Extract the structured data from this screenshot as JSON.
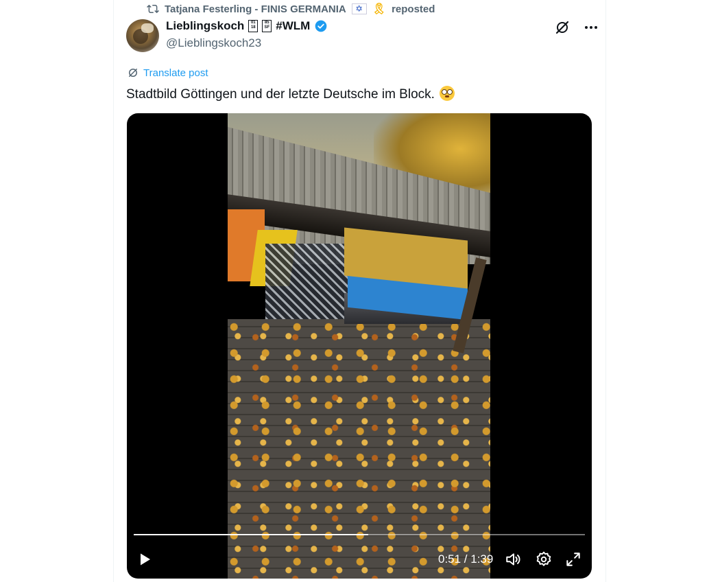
{
  "repost": {
    "user": "Tatjana Festerling - FINIS GERMANIA",
    "action": "reposted"
  },
  "author": {
    "name": "Lieblingskoch",
    "tag": "#WLM",
    "handle": "@Lieblingskoch23"
  },
  "post": {
    "translate_label": "Translate post",
    "text": "Stadtbild Göttingen und der letzte Deutsche im Block."
  },
  "video": {
    "time_display": "0:51 / 1:39",
    "progress_fraction": 0.52
  },
  "icons": {
    "repost": "repost-icon",
    "verified": "verified-badge-icon",
    "grok": "grok-icon",
    "more": "more-icon",
    "translate": "translate-icon",
    "play": "play-icon",
    "volume": "volume-icon",
    "settings": "settings-icon",
    "fullscreen": "fullscreen-icon"
  },
  "colors": {
    "link": "#1d9bf0",
    "secondary_text": "#536471",
    "verified": "#1d9bf0"
  }
}
